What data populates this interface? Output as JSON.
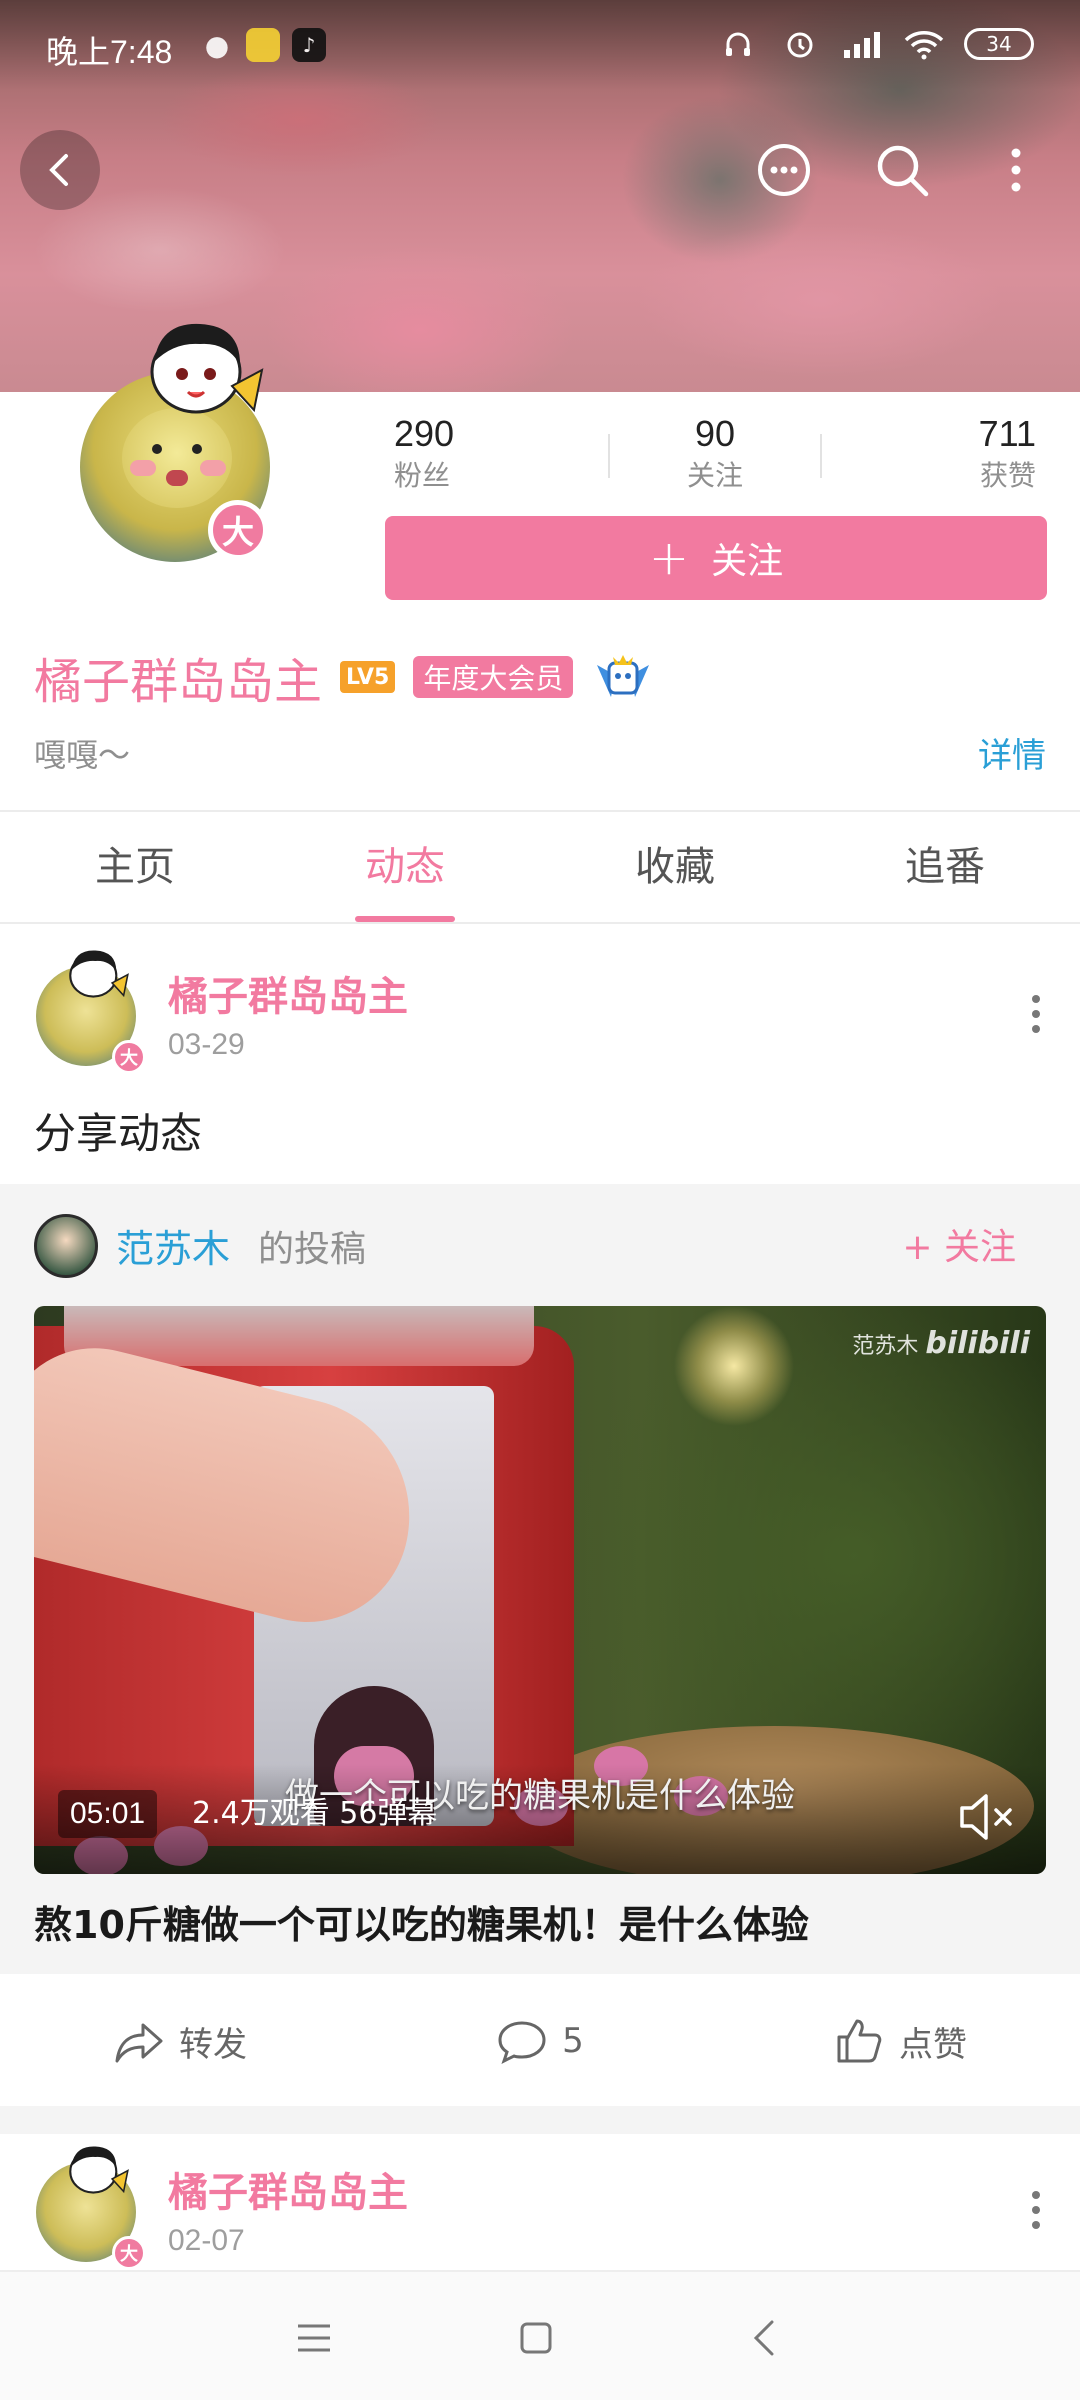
{
  "status_bar": {
    "time": "晚上7:48",
    "battery": "34"
  },
  "profile": {
    "avatar_badge": "大",
    "stats": [
      {
        "value": "290",
        "label": "粉丝"
      },
      {
        "value": "90",
        "label": "关注"
      },
      {
        "value": "711",
        "label": "获赞"
      }
    ],
    "follow_button": "关注",
    "username": "橘子群岛岛主",
    "level_badge": "LV5",
    "vip_badge": "年度大会员",
    "bio": "嘎嘎～",
    "detail_link": "详情"
  },
  "tabs": [
    {
      "label": "主页",
      "active": false
    },
    {
      "label": "动态",
      "active": true
    },
    {
      "label": "收藏",
      "active": false
    },
    {
      "label": "追番",
      "active": false
    }
  ],
  "post": {
    "author": "橘子群岛岛主",
    "date": "03-29",
    "badge": "大",
    "text": "分享动态",
    "repost": {
      "author": "范苏木",
      "suffix": "的投稿",
      "follow_label": "关注",
      "video": {
        "watermark_name": "范苏木",
        "watermark_brand": "bilibili",
        "subtitle": "做一个可以吃的糖果机是什么体验",
        "duration": "05:01",
        "stats": "2.4万观看  56弹幕"
      },
      "title": "熬10斤糖做一个可以吃的糖果机！是什么体验"
    },
    "actions": {
      "share": "转发",
      "comment": "5",
      "like": "点赞"
    }
  },
  "post2": {
    "author": "橘子群岛岛主",
    "date": "02-07",
    "badge": "大"
  },
  "colors": {
    "accent": "#f27aa0",
    "link": "#2a9fd6"
  }
}
